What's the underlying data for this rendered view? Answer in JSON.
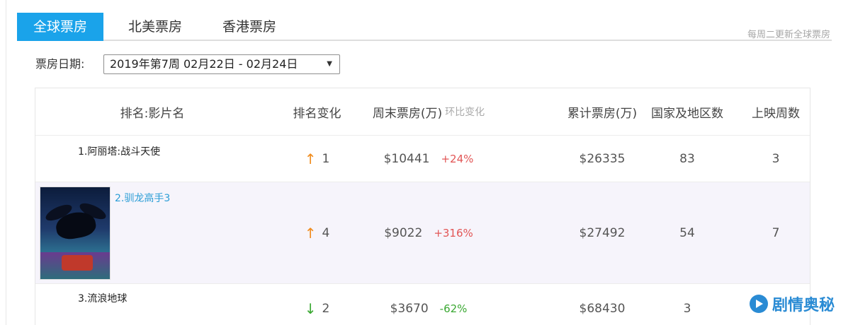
{
  "tabs": [
    {
      "label": "全球票房",
      "active": true
    },
    {
      "label": "北美票房",
      "active": false
    },
    {
      "label": "香港票房",
      "active": false
    }
  ],
  "weekly_note": "每周二更新全球票房",
  "date_filter": {
    "label": "票房日期:",
    "selected": "2019年第7周 02月22日 - 02月24日",
    "caret_icon": "caret-down-icon"
  },
  "table": {
    "headers": {
      "title": "排名:影片名",
      "rank_change": "排名变化",
      "weekend": "周末票房(万)",
      "weekend_sub": "环比变化",
      "total": "累计票房(万)",
      "countries": "国家及地区数",
      "weeks": "上映周数"
    },
    "rows": [
      {
        "name": "1.阿丽塔:战斗天使",
        "direction": "up",
        "change": "1",
        "weekend": "$10441",
        "wow": "+24%",
        "total": "$26335",
        "countries": "83",
        "weeks": "3"
      },
      {
        "name": "2.驯龙高手3",
        "direction": "up",
        "change": "4",
        "weekend": "$9022",
        "wow": "+316%",
        "total": "$27492",
        "countries": "54",
        "weeks": "7"
      },
      {
        "name": "3.流浪地球",
        "direction": "down",
        "change": "2",
        "weekend": "$3670",
        "wow": "-62%",
        "total": "$68430",
        "countries": "3",
        "weeks": ""
      }
    ]
  },
  "watermark": "剧情奥秘",
  "colors": {
    "accent": "#1aa3ea",
    "up": "#f08c1e",
    "down": "#3aa832",
    "positive": "#e25555",
    "link": "#2a9dd6"
  }
}
